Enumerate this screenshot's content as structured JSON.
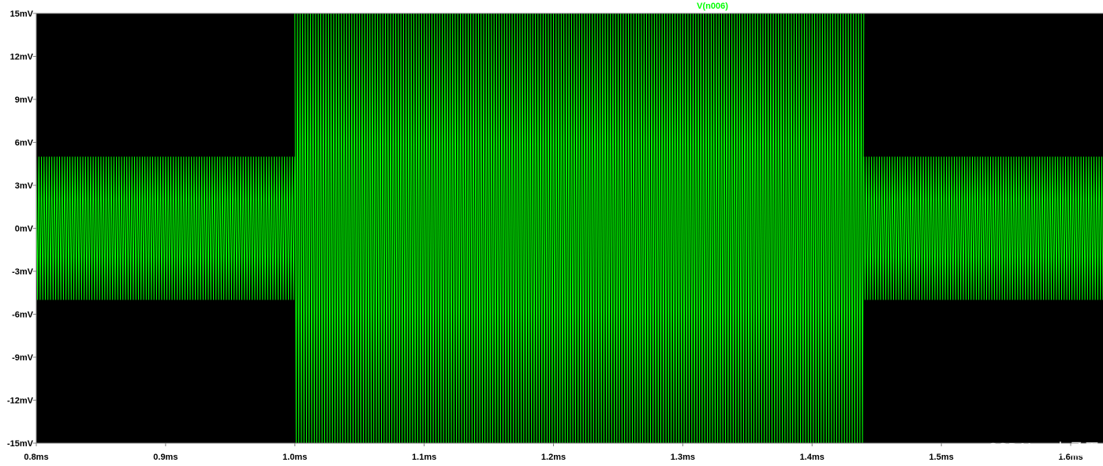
{
  "chart_data": {
    "type": "line",
    "title": "",
    "xlabel": "",
    "ylabel": "",
    "xlim": [
      0.8,
      1.625
    ],
    "ylim": [
      -15,
      15
    ],
    "grid": false,
    "legend_position": "top-center",
    "x_ticks": [
      0.8,
      0.9,
      1.0,
      1.1,
      1.2,
      1.3,
      1.4,
      1.5,
      1.6
    ],
    "x_tick_labels": [
      "0.8ms",
      "0.9ms",
      "1.0ms",
      "1.1ms",
      "1.2ms",
      "1.3ms",
      "1.4ms",
      "1.5ms",
      "1.6ms"
    ],
    "y_ticks": [
      15,
      12,
      9,
      6,
      3,
      0,
      -3,
      -6,
      -9,
      -12,
      -15
    ],
    "y_tick_labels": [
      "15mV",
      "12mV",
      "9mV",
      "6mV",
      "3mV",
      "0mV",
      "-3mV",
      "-6mV",
      "-9mV",
      "-12mV",
      "-15mV"
    ],
    "x_unit": "ms",
    "y_unit": "mV",
    "series": [
      {
        "name": "V(n006)",
        "color": "#00ff00",
        "segments": [
          {
            "x_start": 0.8,
            "x_end": 1.0,
            "amplitude": 5
          },
          {
            "x_start": 1.0,
            "x_end": 1.44,
            "amplitude": 15
          },
          {
            "x_start": 1.44,
            "x_end": 1.625,
            "amplitude": 5
          }
        ],
        "period": 0.002
      }
    ]
  },
  "watermark": "CSDN @吉孟雷",
  "colors": {
    "plot_background": "#000000",
    "page_background": "#ffffff",
    "axis": "#808080",
    "trace": "#00ff00",
    "label_text": "#000000"
  }
}
